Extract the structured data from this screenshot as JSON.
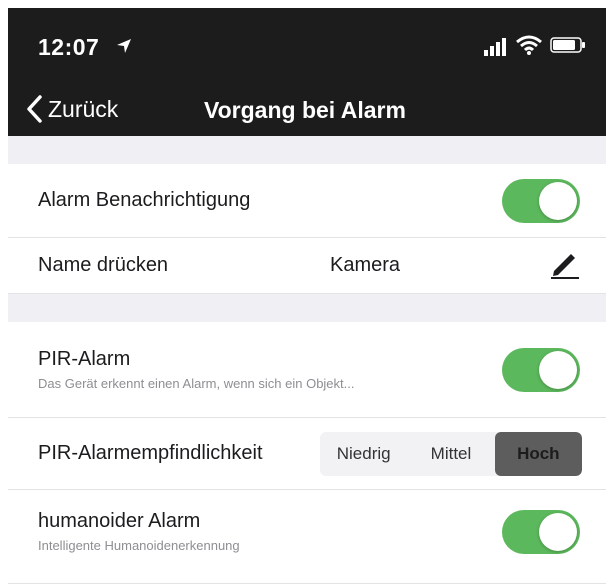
{
  "status_bar": {
    "time": "12:07",
    "icons": [
      "location-arrow-icon",
      "signal-icon",
      "wifi-icon",
      "battery-icon"
    ]
  },
  "nav": {
    "back_label": "Zurück",
    "title": "Vorgang bei Alarm"
  },
  "settings": {
    "alarm_notification": {
      "label": "Alarm Benachrichtigung",
      "enabled": true
    },
    "name_press": {
      "label": "Name drücken",
      "value": "Kamera",
      "icon": "pencil-icon"
    },
    "pir_alarm": {
      "label": "PIR-Alarm",
      "description": "Das Gerät erkennt einen Alarm, wenn sich ein Objekt...",
      "enabled": true
    },
    "pir_sensitivity": {
      "label": "PIR-Alarmempfindlichkeit",
      "options": [
        "Niedrig",
        "Mittel",
        "Hoch"
      ],
      "selected": "Hoch"
    },
    "humanoid_alarm": {
      "label": "humanoider Alarm",
      "description": "Intelligente Humanoidenerkennung",
      "enabled": true
    }
  },
  "colors": {
    "toggle_on": "#5cb85c",
    "header_bg": "#1c1c1c",
    "section_gap": "#efeff4",
    "segment_selected": "#5d5d5d"
  }
}
